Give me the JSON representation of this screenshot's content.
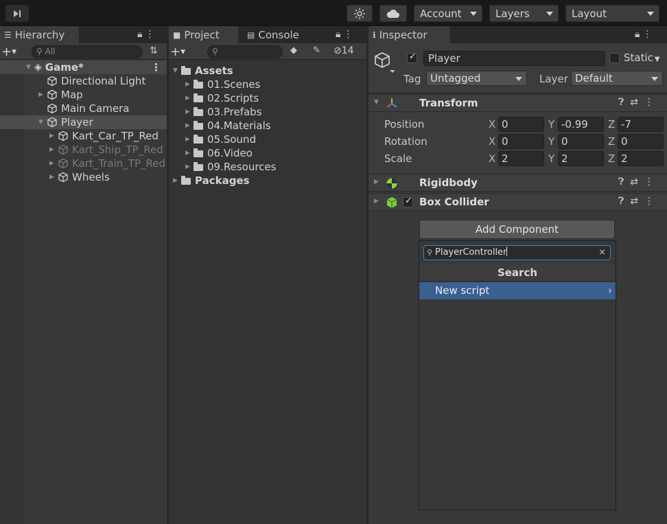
{
  "toolbar": {
    "account_label": "Account",
    "layers_label": "Layers",
    "layout_label": "Layout"
  },
  "hierarchy": {
    "tab_label": "Hierarchy",
    "search_placeholder": "All",
    "items": [
      {
        "label": "Game*"
      },
      {
        "label": "Directional Light"
      },
      {
        "label": "Map"
      },
      {
        "label": "Main Camera"
      },
      {
        "label": "Player"
      },
      {
        "label": "Kart_Car_TP_Red"
      },
      {
        "label": "Kart_Ship_TP_Red"
      },
      {
        "label": "Kart_Train_TP_Red"
      },
      {
        "label": "Wheels"
      }
    ]
  },
  "project": {
    "tab_label": "Project",
    "console_tab_label": "Console",
    "hidden_count": "14",
    "assets_label": "Assets",
    "folders": [
      {
        "label": "01.Scenes"
      },
      {
        "label": "02.Scripts"
      },
      {
        "label": "03.Prefabs"
      },
      {
        "label": "04.Materials"
      },
      {
        "label": "05.Sound"
      },
      {
        "label": "06.Video"
      },
      {
        "label": "09.Resources"
      }
    ],
    "packages_label": "Packages"
  },
  "inspector": {
    "tab_label": "Inspector",
    "object_name": "Player",
    "static_label": "Static",
    "tag_label": "Tag",
    "tag_value": "Untagged",
    "layer_label": "Layer",
    "layer_value": "Default",
    "transform": {
      "title": "Transform",
      "rows": [
        {
          "label": "Position",
          "x": "0",
          "y": "-0.99",
          "z": "-7"
        },
        {
          "label": "Rotation",
          "x": "0",
          "y": "0",
          "z": "0"
        },
        {
          "label": "Scale",
          "x": "2",
          "y": "2",
          "z": "2"
        }
      ],
      "axis_x": "X",
      "axis_y": "Y",
      "axis_z": "Z"
    },
    "rigidbody_title": "Rigidbody",
    "box_collider_title": "Box Collider",
    "add_component_label": "Add Component",
    "popup": {
      "search_value": "PlayerController",
      "title": "Search",
      "item_label": "New script"
    }
  },
  "colors": {
    "selection": "#3a5f91",
    "focus_outline": "#3f82c8",
    "transform_icon_red": "#e0533a",
    "transform_icon_green": "#7bcf3c",
    "transform_icon_blue": "#4c8be0",
    "rigidbody_icon": "#8fd33f",
    "collider_icon": "#7dcc3d"
  }
}
